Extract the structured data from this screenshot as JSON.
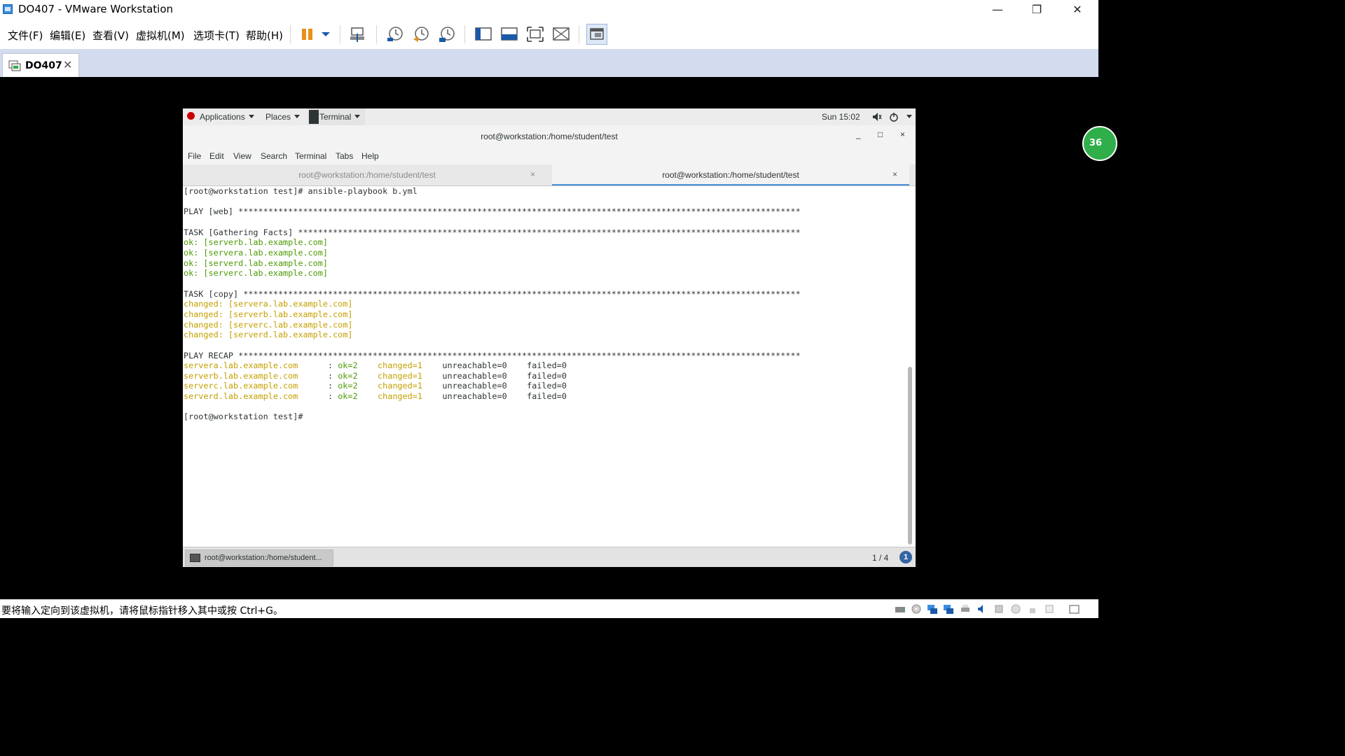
{
  "window": {
    "title": "DO407 - VMware Workstation",
    "minimize": "—",
    "restore": "❐",
    "close": "✕"
  },
  "vmware_menu": [
    "文件(F)",
    "编辑(E)",
    "查看(V)",
    "虚拟机(M)",
    "选项卡(T)",
    "帮助(H)"
  ],
  "vm_tab": {
    "label": "DO407",
    "close": "✕"
  },
  "badge": "36",
  "status": {
    "text": "要将输入定向到该虚拟机，请将鼠标指针移入其中或按 Ctrl+G。"
  },
  "gnome_topbar": {
    "applications": "Applications",
    "places": "Places",
    "terminal": "Terminal",
    "clock": "Sun 15:02"
  },
  "terminal_window": {
    "title": "root@workstation:/home/student/test",
    "min": "_",
    "max": "□",
    "close": "×",
    "menu": [
      "File",
      "Edit",
      "View",
      "Search",
      "Terminal",
      "Tabs",
      "Help"
    ],
    "tabs": [
      {
        "label": "root@workstation:/home/student/test",
        "close": "×",
        "active": false
      },
      {
        "label": "root@workstation:/home/student/test",
        "close": "×",
        "active": true
      }
    ]
  },
  "terminal_lines": [
    {
      "text": "[root@workstation test]# ansible-playbook b.yml",
      "cls": ""
    },
    {
      "text": "",
      "cls": ""
    },
    {
      "text": "PLAY [web] *****************************************************************************************************************",
      "cls": ""
    },
    {
      "text": "",
      "cls": ""
    },
    {
      "text": "TASK [Gathering Facts] *****************************************************************************************************",
      "cls": ""
    },
    {
      "text": "ok: [serverb.lab.example.com]",
      "cls": "ok"
    },
    {
      "text": "ok: [servera.lab.example.com]",
      "cls": "ok"
    },
    {
      "text": "ok: [serverd.lab.example.com]",
      "cls": "ok"
    },
    {
      "text": "ok: [serverc.lab.example.com]",
      "cls": "ok"
    },
    {
      "text": "",
      "cls": ""
    },
    {
      "text": "TASK [copy] ****************************************************************************************************************",
      "cls": ""
    },
    {
      "text": "changed: [servera.lab.example.com]",
      "cls": "ch"
    },
    {
      "text": "changed: [serverb.lab.example.com]",
      "cls": "ch"
    },
    {
      "text": "changed: [serverc.lab.example.com]",
      "cls": "ch"
    },
    {
      "text": "changed: [serverd.lab.example.com]",
      "cls": "ch"
    },
    {
      "text": "",
      "cls": ""
    },
    {
      "text": "PLAY RECAP *****************************************************************************************************************",
      "cls": ""
    }
  ],
  "recap": [
    {
      "host": "servera.lab.example.com",
      "sep": " : ",
      "ok": "ok=2",
      "changed": "changed=1",
      "unreachable": "unreachable=0",
      "failed": "failed=0"
    },
    {
      "host": "serverb.lab.example.com",
      "sep": " : ",
      "ok": "ok=2",
      "changed": "changed=1",
      "unreachable": "unreachable=0",
      "failed": "failed=0"
    },
    {
      "host": "serverc.lab.example.com",
      "sep": " : ",
      "ok": "ok=2",
      "changed": "changed=1",
      "unreachable": "unreachable=0",
      "failed": "failed=0"
    },
    {
      "host": "serverd.lab.example.com",
      "sep": " : ",
      "ok": "ok=2",
      "changed": "changed=1",
      "unreachable": "unreachable=0",
      "failed": "failed=0"
    }
  ],
  "final_prompt": "[root@workstation test]#",
  "bottom_bar": {
    "task_label": "root@workstation:/home/student...",
    "pager": "1 / 4",
    "notif": "1"
  },
  "colors": {
    "ok_green": "#4e9a06",
    "changed_yellow": "#c4a000",
    "pause_orange": "#e8901a",
    "active_tab_underline": "#4a90d9"
  },
  "icons": [
    "pause-icon",
    "send-ctrl-alt-del-icon",
    "snapshot-icon",
    "revert-snapshot-icon",
    "snapshot-manager-icon",
    "library-view-icon",
    "console-view-icon",
    "fullscreen-icon",
    "unity-icon",
    "thumbnail-view-icon"
  ]
}
